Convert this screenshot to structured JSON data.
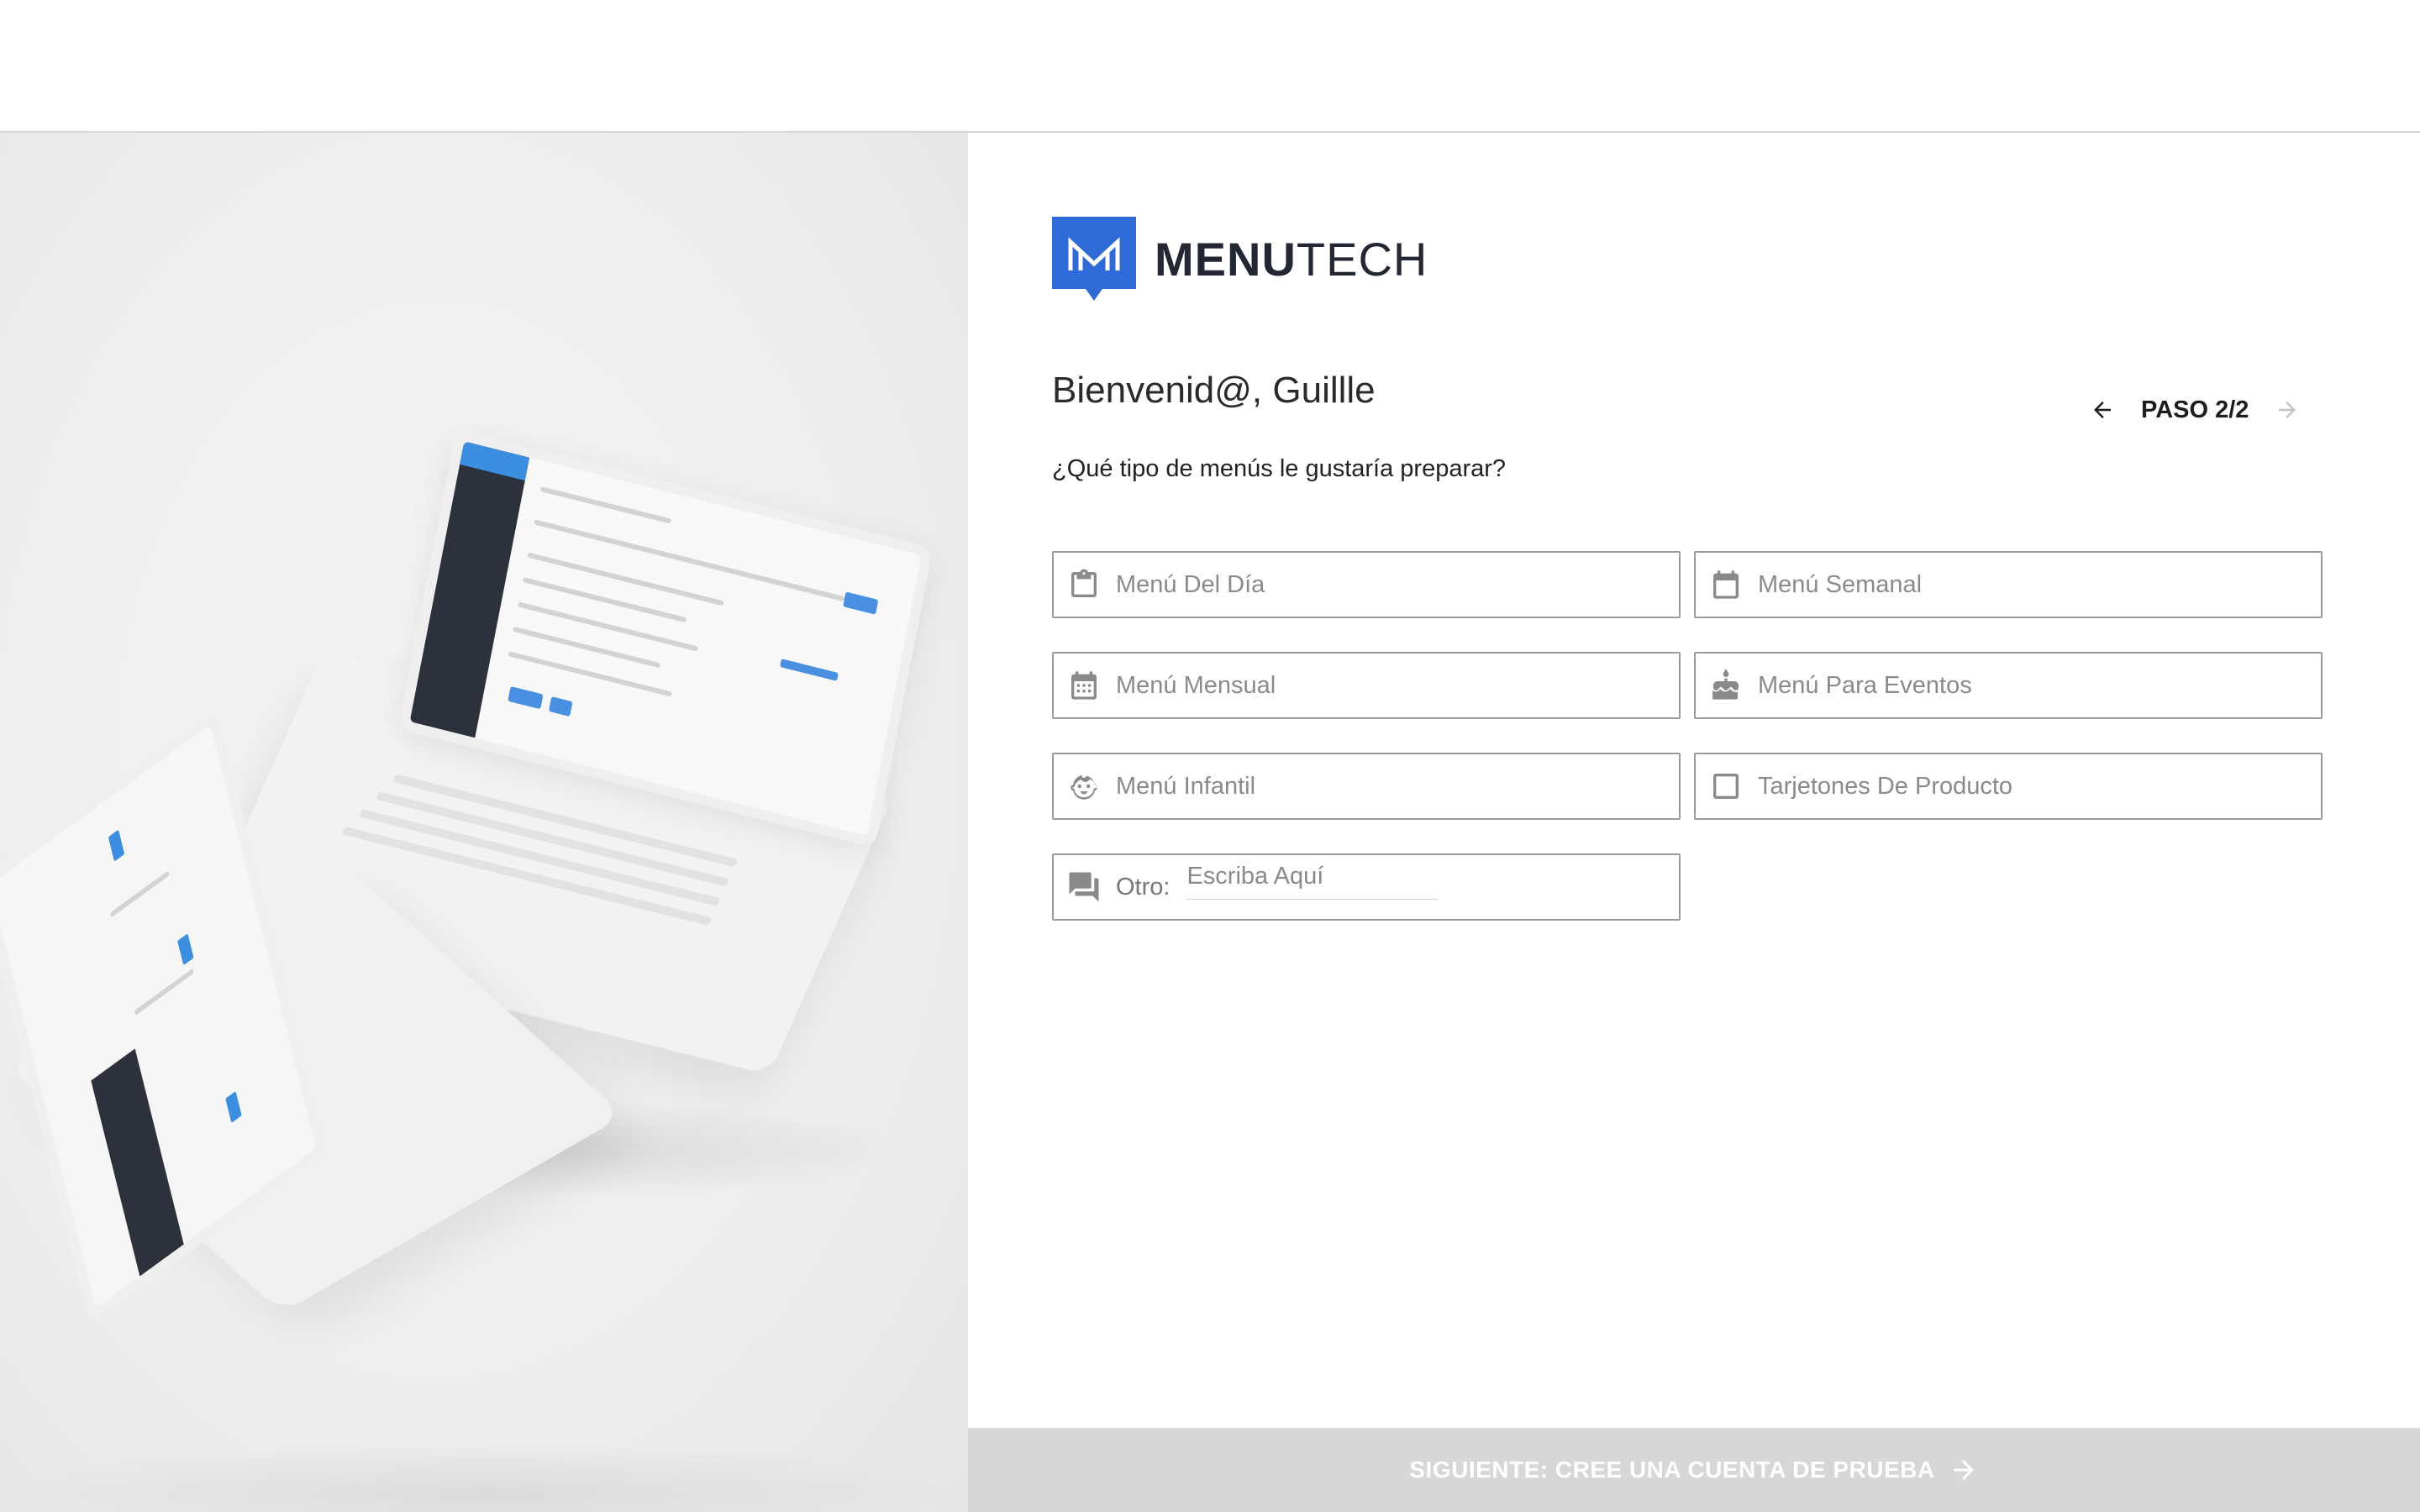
{
  "brand": {
    "name_bold": "MENU",
    "name_light": "TECH",
    "logo_color": "#2f6bd6"
  },
  "header": {
    "welcome": "Bienvenid@, Guillle"
  },
  "stepper": {
    "label": "PASO 2/2"
  },
  "question": "¿Qué tipo de menús le gustaría preparar?",
  "options": [
    {
      "label": "Menú Del Día",
      "icon": "clipboard-icon"
    },
    {
      "label": "Menú Semanal",
      "icon": "calendar-icon"
    },
    {
      "label": "Menú Mensual",
      "icon": "calendar-icon"
    },
    {
      "label": "Menú Para Eventos",
      "icon": "cake-icon"
    },
    {
      "label": "Menú Infantil",
      "icon": "child-face-icon"
    },
    {
      "label": "Tarjetones De Producto",
      "icon": "checkbox-icon"
    }
  ],
  "otro": {
    "label": "Otro:",
    "placeholder": "Escriba Aquí",
    "value": "",
    "icon": "chat-icon"
  },
  "footer": {
    "label": "SIGUIENTE: CREE UNA CUENTA DE PRUEBA"
  },
  "colors": {
    "accent": "#2f6bd6",
    "footer_bg": "#d7d7d7",
    "border": "#9a9a9a",
    "icon_gray": "#8a8a8a"
  }
}
